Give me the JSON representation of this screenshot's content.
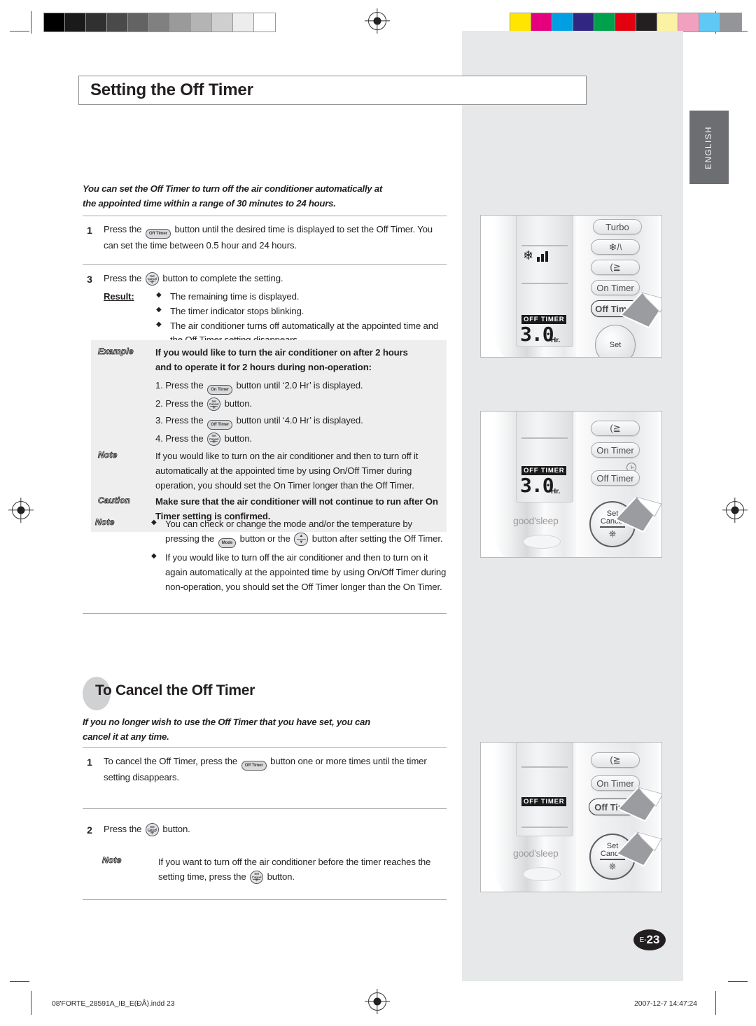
{
  "page": {
    "title": "Setting the Off Timer",
    "language_tab": "ENGLISH",
    "page_number_prefix": "E-",
    "page_number": "23"
  },
  "intro": {
    "line1": "You can set the Off Timer to turn off the air conditioner automatically at",
    "line2": "the appointed time within a range of 30 minutes to 24 hours."
  },
  "steps": [
    {
      "num": "1",
      "pre": "Press the",
      "button": "Off Timer",
      "post": "button until the desired time is displayed to set the Off Timer. You can set the time between 0.5 hour and 24 hours."
    },
    {
      "num": "3",
      "pre": "Press the",
      "button_l1": "Set",
      "button_l2": "Cancel",
      "post": "button to complete the setting.",
      "result_label": "Result:",
      "results": [
        "The remaining time is displayed.",
        "The timer indicator stops blinking.",
        "The air conditioner turns off automatically at the appointed time and the Off Timer setting disappears."
      ]
    }
  ],
  "callout": {
    "example": {
      "tag": "Example",
      "line1": "If you would like to turn the air conditioner on after 2 hours",
      "line2": "and to operate it for 2 hours during non-operation:",
      "substeps": [
        {
          "index": "1. Press the",
          "button": "On Timer",
          "tail": "button until ‘2.0 Hr’ is displayed."
        },
        {
          "index": "2. Press the",
          "button_l1": "Set",
          "button_l2": "Cancel",
          "tail": "button."
        },
        {
          "index": "3. Press the",
          "button": "Off Timer",
          "tail": "button until ‘4.0 Hr’ is displayed."
        },
        {
          "index": "4. Press the",
          "button_l1": "Set",
          "button_l2": "Cancel",
          "tail": "button."
        }
      ]
    },
    "note": {
      "tag": "Note",
      "text": "If you would like to turn on the air conditioner and then to turn off it automatically at the appointed time by using On/Off Timer during operation, you should set the On Timer longer than the Off Timer."
    },
    "caution": {
      "tag": "Caution",
      "text": "Make sure that the air conditioner will not continue to run after On Timer setting is confirmed."
    }
  },
  "note_block": {
    "tag": "Note",
    "bullet1_pre": "You can check or change the mode and/or the temperature by pressing the",
    "bullet1_btn1": "Mode",
    "bullet1_mid": "button or the",
    "bullet1_post": "button after setting the Off Timer.",
    "bullet2": "If you would like to turn off the air conditioner and then to turn on it again automatically at the appointed time by using On/Off Timer during non-operation, you should set the Off Timer longer than the On Timer."
  },
  "section2": {
    "heading": "To Cancel the Off Timer",
    "intro_line1": "If you no longer wish to use the Off Timer that you have set, you can",
    "intro_line2": "cancel it at any time.",
    "steps": [
      {
        "num": "1",
        "pre": "To cancel the Off Timer, press the",
        "button": "Off Timer",
        "post": "button one or more times until the timer setting disappears."
      },
      {
        "num": "2",
        "pre": "Press the",
        "button_l1": "Set",
        "button_l2": "Cancel",
        "post": "button."
      }
    ],
    "note": {
      "tag": "Note",
      "pre": "If you want to turn off the air conditioner before the timer reaches the setting time, press the",
      "button_l1": "Set",
      "button_l2": "Cancel",
      "post": "button."
    }
  },
  "figures": [
    {
      "name": "remote-figure-1",
      "lcd_badge": "OFF  TIMER",
      "lcd_value": "3.0",
      "lcd_unit": "Hr.",
      "buttons": [
        "Turbo",
        "fan-speed-icon",
        "air-swing-icon",
        "On Timer",
        "Off Timer",
        "Set"
      ],
      "highlighted_button": "Off Timer"
    },
    {
      "name": "remote-figure-2",
      "lcd_badge": "OFF  TIMER",
      "lcd_value": "3.0",
      "lcd_unit": "Hr.",
      "brand": "good’sleep",
      "buttons": [
        "air-swing-icon",
        "On Timer",
        "Off Timer",
        "Set Cancel"
      ],
      "set_button_l1": "Set",
      "set_button_l2": "Cancel",
      "highlighted_button": "Set Cancel"
    },
    {
      "name": "remote-figure-3",
      "lcd_badge": "OFF  TIMER",
      "brand": "good’sleep",
      "buttons": [
        "air-swing-icon",
        "On Timer",
        "Off Timer",
        "Set Cancel"
      ],
      "set_button_l1": "Set",
      "set_button_l2": "Cancel",
      "highlighted_buttons": [
        "Off Timer",
        "Set Cancel"
      ]
    }
  ],
  "printbars": {
    "grayscale": [
      "#000000",
      "#1a1a1a",
      "#303030",
      "#4a4a4a",
      "#636363",
      "#808080",
      "#9a9a9a",
      "#b4b4b4",
      "#cfcfcf",
      "#ededed",
      "#ffffff"
    ],
    "color": [
      "#ffe500",
      "#e6007e",
      "#009fe3",
      "#312783",
      "#00a14b",
      "#e3000f",
      "#231f20",
      "#fbf3a3",
      "#f2a0c0",
      "#5fc8f5",
      "#939598"
    ]
  },
  "footer": {
    "file": "08'FORTE_28591A_IB_E(ĐÅ).indd   23",
    "date": "2007-12-7   14:47:24"
  }
}
